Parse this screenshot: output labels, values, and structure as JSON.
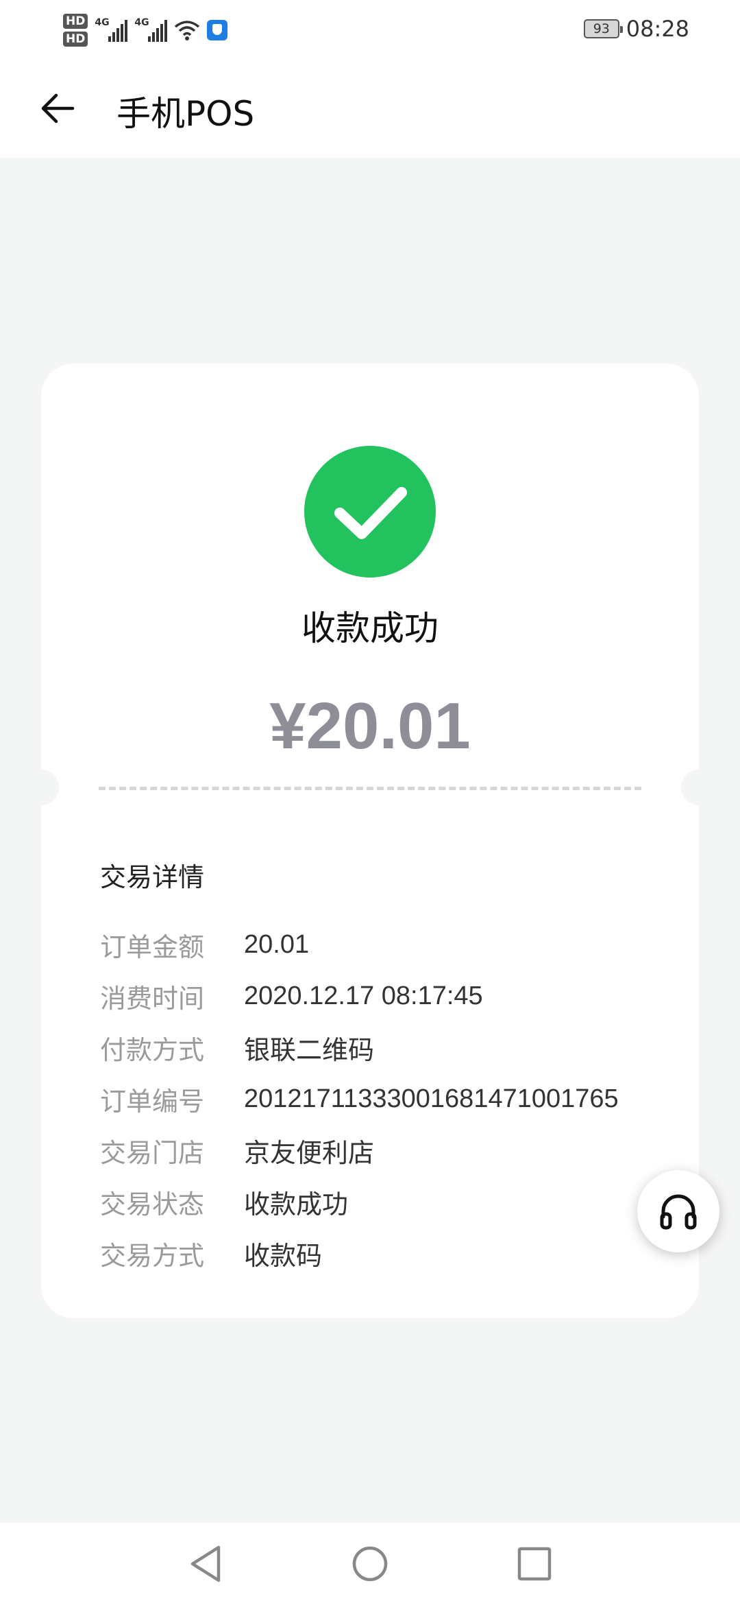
{
  "status_bar": {
    "hd1": "HD",
    "hd2": "HD",
    "net1": "4G",
    "net2": "4G",
    "battery": "93",
    "time": "08:28"
  },
  "app_bar": {
    "title": "手机POS"
  },
  "result": {
    "title": "收款成功",
    "amount": "¥20.01"
  },
  "details": {
    "section_title": "交易详情",
    "rows": [
      {
        "label": "订单金额",
        "value": "20.01"
      },
      {
        "label": "消费时间",
        "value": "2020.12.17 08:17:45"
      },
      {
        "label": "付款方式",
        "value": "银联二维码"
      },
      {
        "label": "订单编号",
        "value": "20121711333001681471001765"
      },
      {
        "label": "交易门店",
        "value": "京友便利店"
      },
      {
        "label": "交易状态",
        "value": "收款成功"
      },
      {
        "label": "交易方式",
        "value": "收款码"
      }
    ]
  },
  "colors": {
    "success_green": "#22c25e",
    "amount_gray": "#8e8e98",
    "background": "#f4f5f5"
  },
  "icons": {
    "back": "arrow-left-icon",
    "success": "check-circle-icon",
    "support": "headphones-icon",
    "nav_back": "triangle-back-icon",
    "nav_home": "circle-home-icon",
    "nav_recent": "square-recent-icon"
  }
}
